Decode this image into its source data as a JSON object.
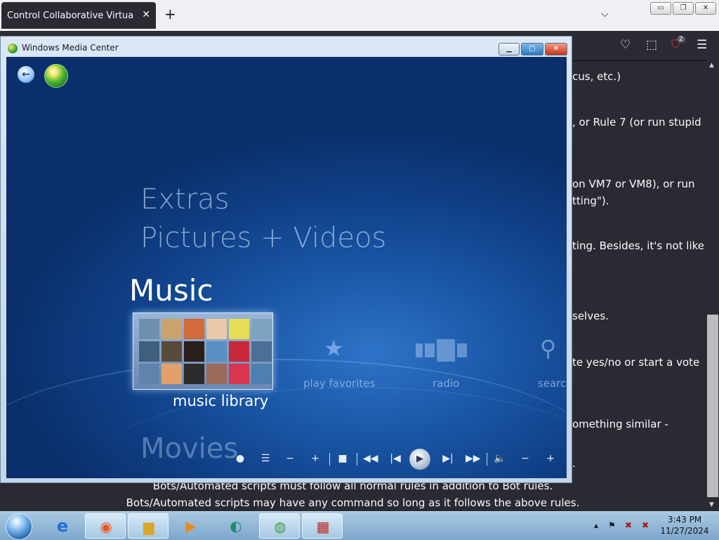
{
  "browser": {
    "tab_title": "Control Collaborative Virtual Machi",
    "close_glyph": "✕",
    "new_tab_glyph": "+",
    "tab_list_glyph": "⌵",
    "toolbar_icons": [
      "pocket-icon",
      "extensions-icon",
      "ublock-icon",
      "menu-icon"
    ],
    "ublock_badge": "2"
  },
  "page": {
    "right_fragments": [
      "cus, etc.)",
      ", or Rule 7 (or run stupid",
      " on VM7 or VM8), or run",
      "tting\").",
      "ting. Besides, it's not like",
      "selves.",
      "te yes/no or start a vote",
      "omething similar -",
      "."
    ],
    "bottom_lines": [
      "Bots/Automated scripts must follow all normal rules in addition to Bot rules.",
      "Bots/Automated scripts may have any command so long as it follows the above rules."
    ]
  },
  "wmc": {
    "title": "Windows Media Center",
    "menu": {
      "extras": "Extras",
      "pictures": "Pictures + Videos",
      "music": "Music",
      "movies": "Movies"
    },
    "strip": {
      "music_library": "music library",
      "play_favorites": "play favorites",
      "radio": "radio",
      "search": "search"
    },
    "transport_icons": [
      "record-icon",
      "guide-icon",
      "channel-down-icon",
      "channel-up-icon",
      "stop-icon",
      "rewind-icon",
      "previous-icon",
      "play-icon",
      "next-icon",
      "fast-forward-icon",
      "mute-icon",
      "volume-down-icon",
      "volume-up-icon"
    ],
    "album_colors": [
      "#6f8fae",
      "#c9a36b",
      "#d26a3a",
      "#e8c9a8",
      "#e7dc54",
      "#7da2c2",
      "#3e5f7f",
      "#5a4a3a",
      "#2a1e1a",
      "#5b8fc3",
      "#c8283a",
      "#4b6f96",
      "#5e84ad",
      "#e3a06b",
      "#2b2b2b",
      "#9c6a5a",
      "#d93550",
      "#4d7fb0"
    ]
  },
  "taskbar": {
    "apps": [
      "internet-explorer-icon",
      "firefox-icon",
      "explorer-icon",
      "media-player-icon",
      "media-center-icon",
      "windows-media-center-active-icon",
      "toolbox-icon"
    ],
    "time": "3:43 PM",
    "date": "11/27/2024"
  }
}
